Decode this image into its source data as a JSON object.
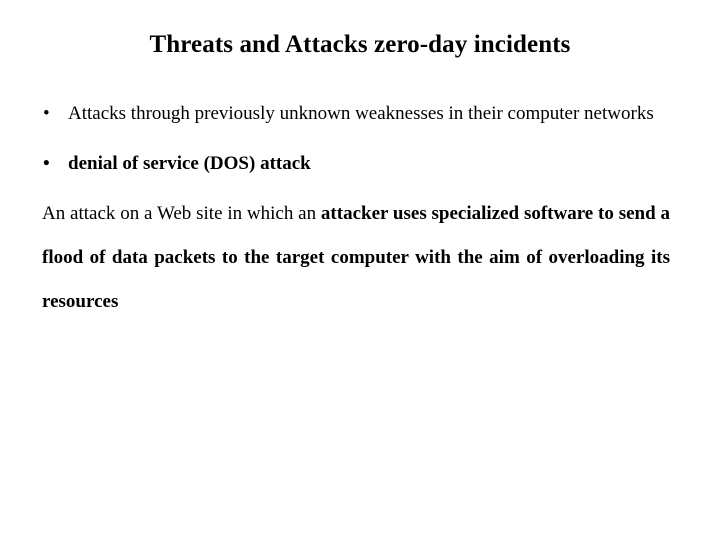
{
  "slide": {
    "title": "Threats and Attacks zero-day incidents",
    "bullet_glyph": "•",
    "bullets": [
      {
        "text": "Attacks through previously unknown weaknesses in their computer networks",
        "bold": false
      },
      {
        "text": "denial of service (DOS) attack",
        "bold": true
      }
    ],
    "paragraph": {
      "regular_part": "An attack on a Web site in which an ",
      "bold_part": "attacker uses specialized software to send a flood of data packets to the target computer with the aim of overloading its resources"
    }
  },
  "colors": {
    "background": "#ffffff",
    "text": "#000000"
  }
}
